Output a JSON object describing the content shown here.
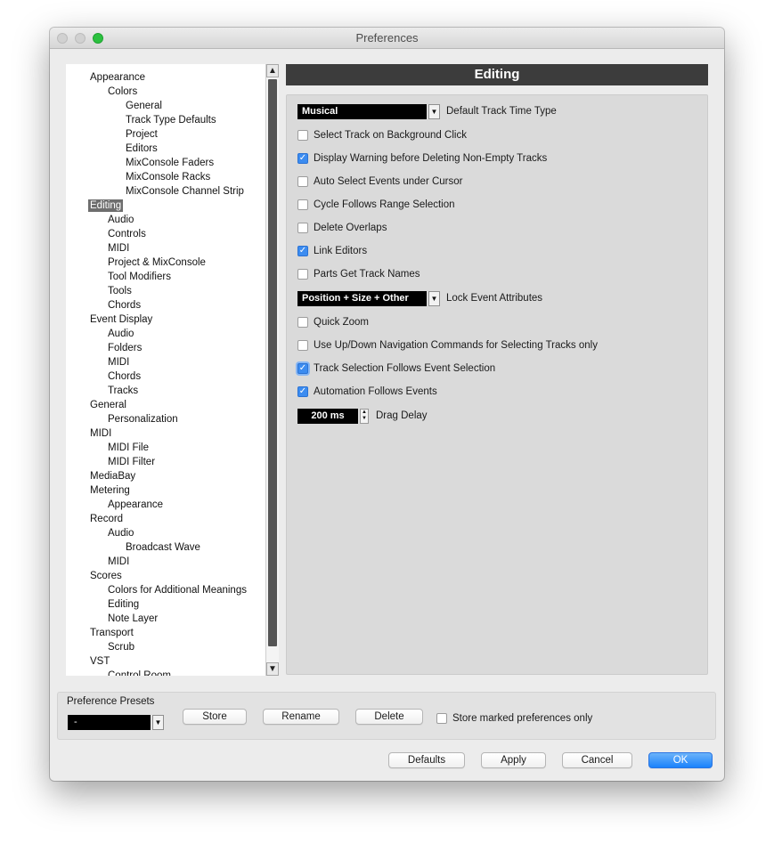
{
  "window": {
    "title": "Preferences"
  },
  "tree": {
    "items": [
      {
        "label": "Appearance",
        "level": 0
      },
      {
        "label": "Colors",
        "level": 1
      },
      {
        "label": "General",
        "level": 2
      },
      {
        "label": "Track Type Defaults",
        "level": 2
      },
      {
        "label": "Project",
        "level": 2
      },
      {
        "label": "Editors",
        "level": 2
      },
      {
        "label": "MixConsole Faders",
        "level": 2
      },
      {
        "label": "MixConsole Racks",
        "level": 2
      },
      {
        "label": "MixConsole Channel Strip",
        "level": 2
      },
      {
        "label": "Editing",
        "level": 0,
        "selected": true
      },
      {
        "label": "Audio",
        "level": 1
      },
      {
        "label": "Controls",
        "level": 1
      },
      {
        "label": "MIDI",
        "level": 1
      },
      {
        "label": "Project & MixConsole",
        "level": 1
      },
      {
        "label": "Tool Modifiers",
        "level": 1
      },
      {
        "label": "Tools",
        "level": 1
      },
      {
        "label": "Chords",
        "level": 1
      },
      {
        "label": "Event Display",
        "level": 0
      },
      {
        "label": "Audio",
        "level": 1
      },
      {
        "label": "Folders",
        "level": 1
      },
      {
        "label": "MIDI",
        "level": 1
      },
      {
        "label": "Chords",
        "level": 1
      },
      {
        "label": "Tracks",
        "level": 1
      },
      {
        "label": "General",
        "level": 0
      },
      {
        "label": "Personalization",
        "level": 1
      },
      {
        "label": "MIDI",
        "level": 0
      },
      {
        "label": "MIDI File",
        "level": 1
      },
      {
        "label": "MIDI Filter",
        "level": 1
      },
      {
        "label": "MediaBay",
        "level": 0
      },
      {
        "label": "Metering",
        "level": 0
      },
      {
        "label": "Appearance",
        "level": 1
      },
      {
        "label": "Record",
        "level": 0
      },
      {
        "label": "Audio",
        "level": 1
      },
      {
        "label": "Broadcast Wave",
        "level": 2
      },
      {
        "label": "MIDI",
        "level": 1
      },
      {
        "label": "Scores",
        "level": 0
      },
      {
        "label": "Colors for Additional Meanings",
        "level": 1
      },
      {
        "label": "Editing",
        "level": 1
      },
      {
        "label": "Note Layer",
        "level": 1
      },
      {
        "label": "Transport",
        "level": 0
      },
      {
        "label": "Scrub",
        "level": 1
      },
      {
        "label": "VST",
        "level": 0
      },
      {
        "label": "Control Room",
        "level": 1
      }
    ]
  },
  "panel": {
    "title": "Editing",
    "time_type": {
      "value": "Musical",
      "label": "Default Track Time Type"
    },
    "options_a": [
      {
        "label": "Select Track on Background Click",
        "checked": false
      },
      {
        "label": "Display Warning before Deleting Non-Empty Tracks",
        "checked": true
      },
      {
        "label": "Auto Select Events under Cursor",
        "checked": false
      },
      {
        "label": "Cycle Follows Range Selection",
        "checked": false
      },
      {
        "label": "Delete Overlaps",
        "checked": false
      },
      {
        "label": "Link Editors",
        "checked": true
      },
      {
        "label": "Parts Get Track Names",
        "checked": false
      }
    ],
    "lock_attributes": {
      "value": "Position + Size + Other",
      "label": "Lock Event Attributes"
    },
    "options_b": [
      {
        "label": "Quick Zoom",
        "checked": false
      },
      {
        "label": "Use Up/Down Navigation Commands for Selecting Tracks only",
        "checked": false
      },
      {
        "label": "Track Selection Follows Event Selection",
        "checked": true,
        "focused": true
      },
      {
        "label": "Automation Follows Events",
        "checked": true
      }
    ],
    "drag_delay": {
      "value": "200 ms",
      "label": "Drag Delay"
    }
  },
  "presets": {
    "title": "Preference Presets",
    "selected": "-",
    "store_label": "Store",
    "rename_label": "Rename",
    "delete_label": "Delete",
    "store_marked_label": "Store marked preferences only",
    "store_marked_checked": false
  },
  "footer": {
    "defaults_label": "Defaults",
    "apply_label": "Apply",
    "cancel_label": "Cancel",
    "ok_label": "OK"
  },
  "colors": {
    "accent": "#1a82fb",
    "checkbox_checked": "#3c8cf0",
    "header_bg": "#3c3c3c",
    "tree_selected_bg": "#6e6e6e"
  }
}
